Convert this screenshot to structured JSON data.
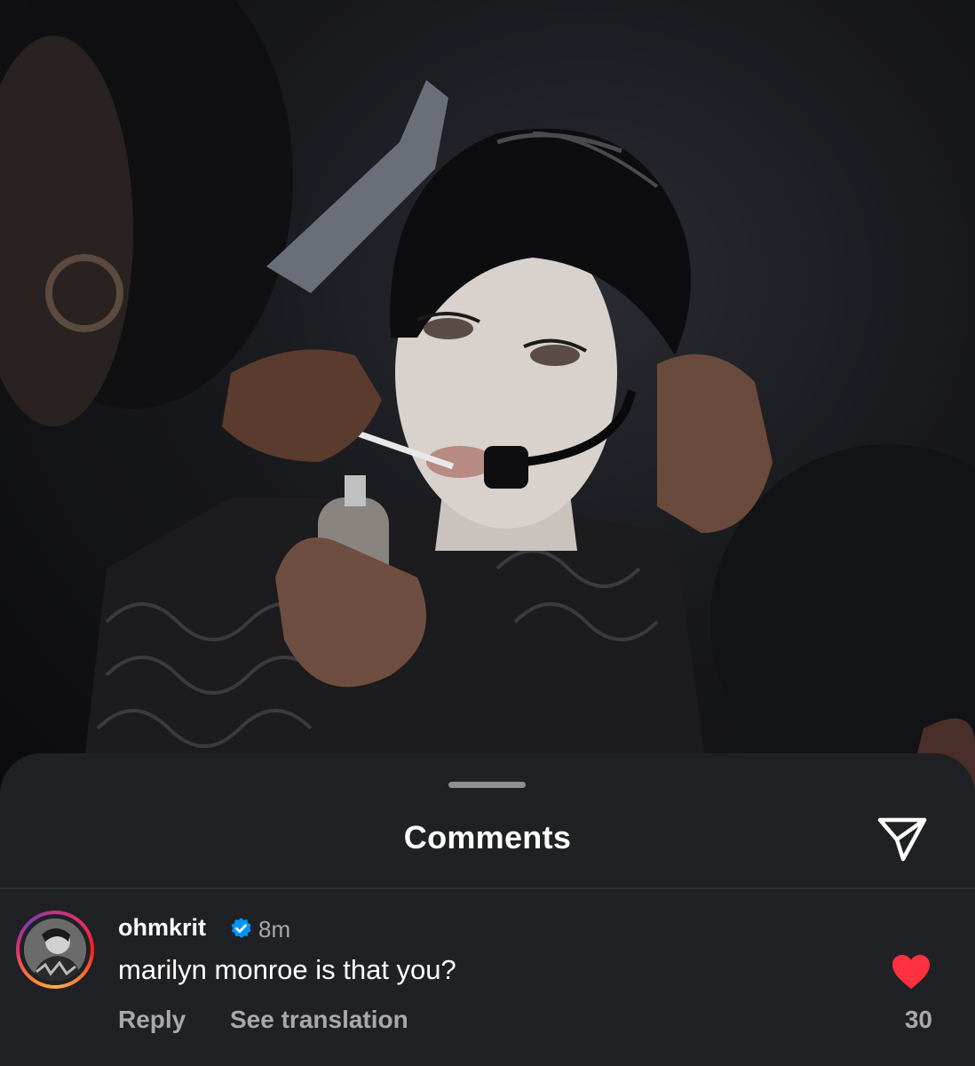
{
  "photo": {
    "icon": "photo-makeup-backstage"
  },
  "sheet": {
    "title": "Comments",
    "share_icon": "paper-plane-icon"
  },
  "comment": {
    "username": "ohmkrit",
    "verified": true,
    "time": "8m",
    "text": "marilyn monroe is that you?",
    "reply_label": "Reply",
    "translate_label": "See translation",
    "likes": "30",
    "liked": true
  },
  "colors": {
    "sheet_bg": "#202124",
    "text_primary": "#ffffff",
    "text_secondary": "#a8a8ad",
    "like_red": "#ff3040",
    "verified_blue": "#0095f6"
  }
}
